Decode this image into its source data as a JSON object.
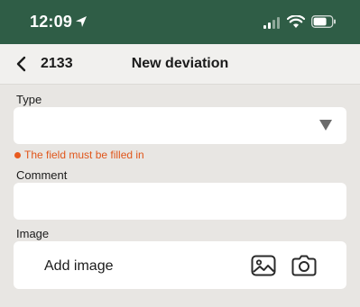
{
  "status_bar": {
    "time": "12:09",
    "icons": [
      "location-arrow-icon",
      "signal-icon",
      "wifi-icon",
      "battery-icon"
    ],
    "background_color": "#2f5d46"
  },
  "nav": {
    "back_icon": "chevron-left-icon",
    "number": "2133",
    "title": "New deviation"
  },
  "form": {
    "type": {
      "label": "Type",
      "value": "",
      "dropdown_icon": "triangle-down-icon",
      "error": "The field must be filled in",
      "error_color": "#e0561b"
    },
    "comment": {
      "label": "Comment",
      "value": ""
    },
    "image": {
      "label": "Image",
      "add_label": "Add image",
      "icons": [
        "gallery-icon",
        "camera-icon"
      ]
    }
  }
}
